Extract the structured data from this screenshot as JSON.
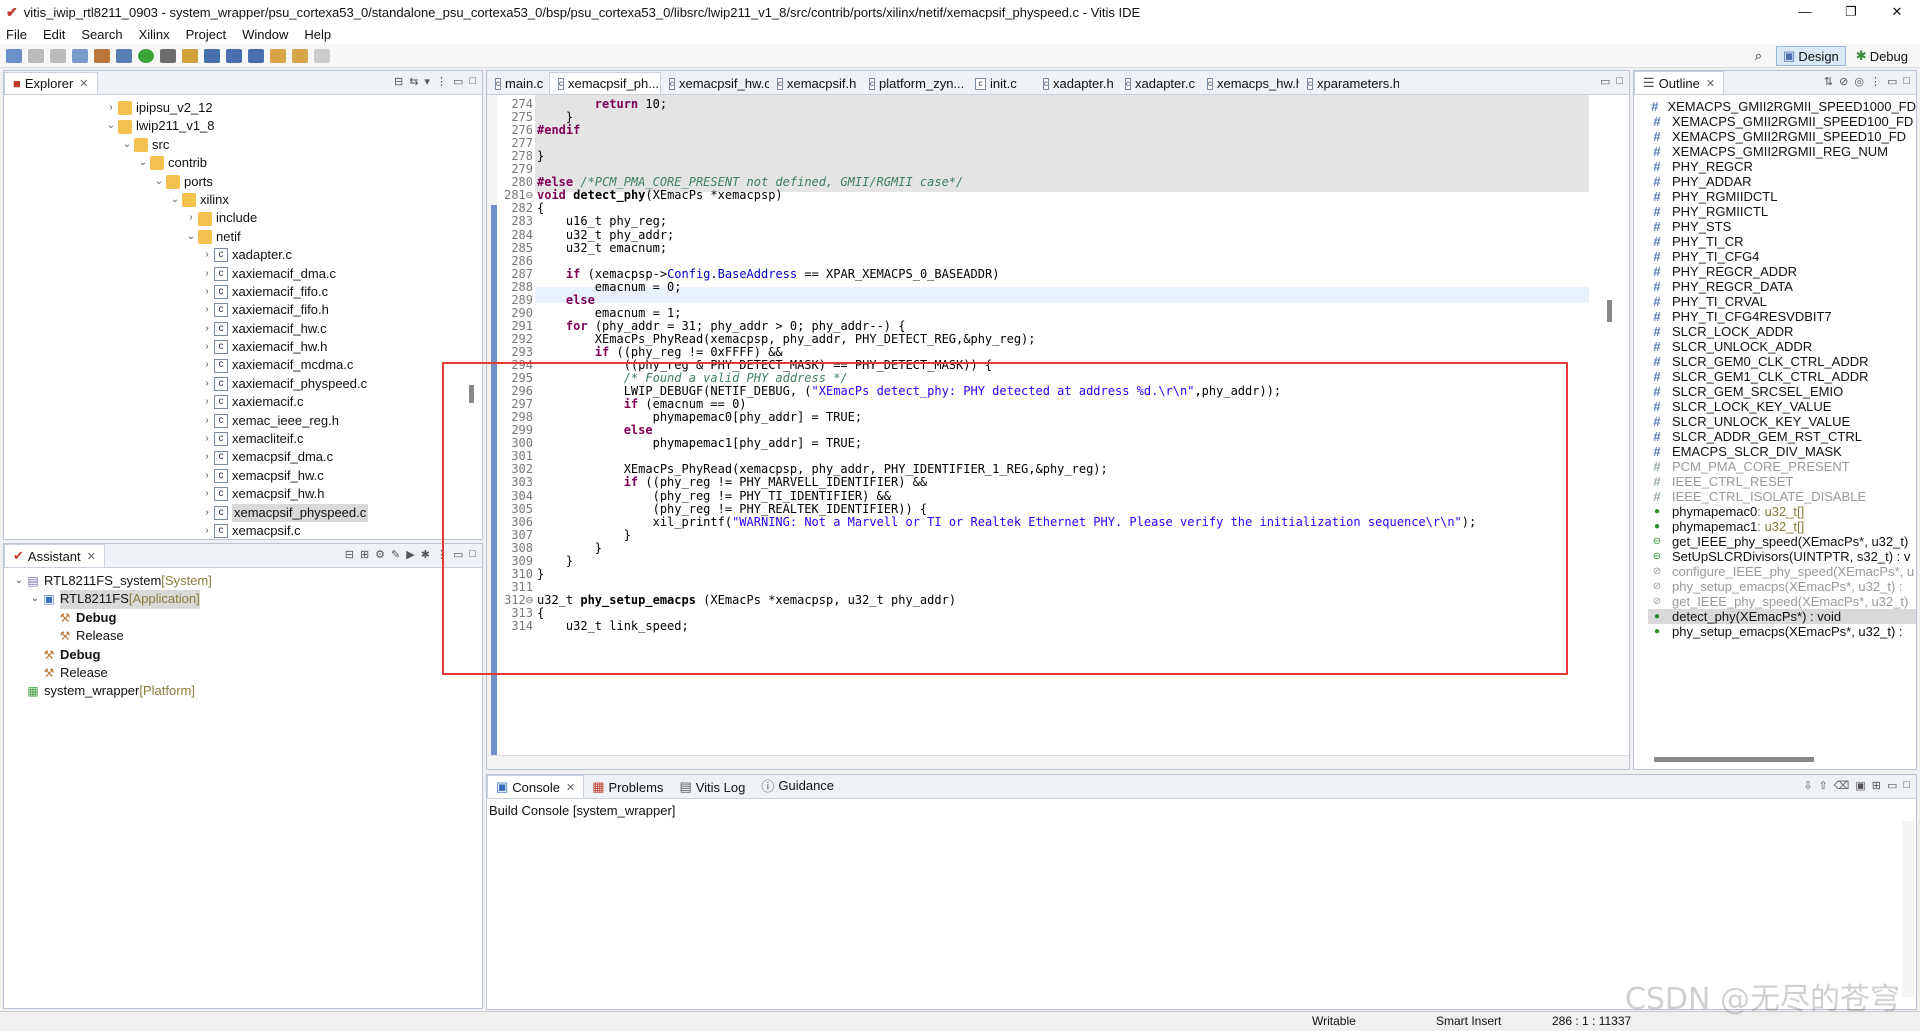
{
  "window": {
    "title": "vitis_iwip_rtl8211_0903 - system_wrapper/psu_cortexa53_0/standalone_psu_cortexa53_0/bsp/psu_cortexa53_0/libsrc/lwip211_v1_8/src/contrib/ports/xilinx/netif/xemacpsif_physpeed.c - Vitis IDE"
  },
  "menu": [
    "File",
    "Edit",
    "Search",
    "Xilinx",
    "Project",
    "Window",
    "Help"
  ],
  "perspectives": {
    "design": "Design",
    "debug": "Debug"
  },
  "explorer": {
    "tab": "Explorer",
    "items": [
      {
        "label": "ipipsu_v2_12",
        "depth": 6,
        "kind": "folder",
        "arrow": "›"
      },
      {
        "label": "lwip211_v1_8",
        "depth": 6,
        "kind": "folder",
        "arrow": "⌄"
      },
      {
        "label": "src",
        "depth": 7,
        "kind": "folder",
        "arrow": "⌄"
      },
      {
        "label": "contrib",
        "depth": 8,
        "kind": "folder",
        "arrow": "⌄"
      },
      {
        "label": "ports",
        "depth": 9,
        "kind": "folder",
        "arrow": "⌄"
      },
      {
        "label": "xilinx",
        "depth": 10,
        "kind": "folder",
        "arrow": "⌄"
      },
      {
        "label": "include",
        "depth": 11,
        "kind": "folder",
        "arrow": "›"
      },
      {
        "label": "netif",
        "depth": 11,
        "kind": "folder",
        "arrow": "⌄"
      },
      {
        "label": "xadapter.c",
        "depth": 12,
        "kind": "file",
        "arrow": "›"
      },
      {
        "label": "xaxiemacif_dma.c",
        "depth": 12,
        "kind": "file",
        "arrow": "›"
      },
      {
        "label": "xaxiemacif_fifo.c",
        "depth": 12,
        "kind": "file",
        "arrow": "›"
      },
      {
        "label": "xaxiemacif_fifo.h",
        "depth": 12,
        "kind": "file",
        "arrow": "›"
      },
      {
        "label": "xaxiemacif_hw.c",
        "depth": 12,
        "kind": "file",
        "arrow": "›"
      },
      {
        "label": "xaxiemacif_hw.h",
        "depth": 12,
        "kind": "file",
        "arrow": "›"
      },
      {
        "label": "xaxiemacif_mcdma.c",
        "depth": 12,
        "kind": "file",
        "arrow": "›"
      },
      {
        "label": "xaxiemacif_physpeed.c",
        "depth": 12,
        "kind": "file",
        "arrow": "›"
      },
      {
        "label": "xaxiemacif.c",
        "depth": 12,
        "kind": "file",
        "arrow": "›"
      },
      {
        "label": "xemac_ieee_reg.h",
        "depth": 12,
        "kind": "file",
        "arrow": "›"
      },
      {
        "label": "xemacliteif.c",
        "depth": 12,
        "kind": "file",
        "arrow": "›"
      },
      {
        "label": "xemacpsif_dma.c",
        "depth": 12,
        "kind": "file",
        "arrow": "›"
      },
      {
        "label": "xemacpsif_hw.c",
        "depth": 12,
        "kind": "file",
        "arrow": "›"
      },
      {
        "label": "xemacpsif_hw.h",
        "depth": 12,
        "kind": "file",
        "arrow": "›"
      },
      {
        "label": "xemacpsif_physpeed.c",
        "depth": 12,
        "kind": "file",
        "arrow": "›",
        "selected": true
      },
      {
        "label": "xemacpsif.c",
        "depth": 12,
        "kind": "file",
        "arrow": "›"
      }
    ]
  },
  "assistant": {
    "tab": "Assistant",
    "items": [
      {
        "label": "RTL8211FS_system",
        "suffix": " [System]",
        "depth": 0,
        "arrow": "⌄",
        "icon": "sys"
      },
      {
        "label": "RTL8211FS",
        "suffix": " [Application]",
        "depth": 1,
        "arrow": "⌄",
        "icon": "app",
        "selected": true
      },
      {
        "label": "Debug",
        "suffix": "",
        "depth": 2,
        "arrow": "",
        "icon": "hammer",
        "bold": true
      },
      {
        "label": "Release",
        "suffix": "",
        "depth": 2,
        "arrow": "",
        "icon": "hammer"
      },
      {
        "label": "Debug",
        "suffix": "",
        "depth": 1,
        "arrow": "",
        "icon": "hammer",
        "bold": true
      },
      {
        "label": "Release",
        "suffix": "",
        "depth": 1,
        "arrow": "",
        "icon": "hammer"
      },
      {
        "label": "system_wrapper",
        "suffix": " [Platform]",
        "depth": 0,
        "arrow": "",
        "icon": "plat"
      }
    ]
  },
  "editor": {
    "tabs": [
      "main.c",
      "xemacpsif_ph...",
      "xemacpsif_hw.c",
      "xemacpsif.h",
      "platform_zyn...",
      "init.c",
      "xadapter.h",
      "xadapter.c",
      "xemacps_hw.h",
      "xparameters.h"
    ],
    "active_tab": 1,
    "lines": [
      {
        "n": "274",
        "t": "        return 10;"
      },
      {
        "n": "275",
        "t": "    }"
      },
      {
        "n": "276",
        "t": "#endif"
      },
      {
        "n": "277",
        "t": ""
      },
      {
        "n": "278",
        "t": "}"
      },
      {
        "n": "279",
        "t": ""
      },
      {
        "n": "280",
        "t": "#else /*PCM_PMA_CORE_PRESENT not defined, GMII/RGMII case*/"
      },
      {
        "n": "281⊖",
        "t": "void detect_phy(XEmacPs *xemacpsp)"
      },
      {
        "n": "282",
        "t": "{"
      },
      {
        "n": "283",
        "t": "    u16_t phy_reg;"
      },
      {
        "n": "284",
        "t": "    u32_t phy_addr;"
      },
      {
        "n": "285",
        "t": "    u32_t emacnum;"
      },
      {
        "n": "286",
        "t": ""
      },
      {
        "n": "287",
        "t": "    if (xemacpsp->Config.BaseAddress == XPAR_XEMACPS_0_BASEADDR)"
      },
      {
        "n": "288",
        "t": "        emacnum = 0;"
      },
      {
        "n": "289",
        "t": "    else"
      },
      {
        "n": "290",
        "t": "        emacnum = 1;"
      },
      {
        "n": "291",
        "t": "    for (phy_addr = 31; phy_addr > 0; phy_addr--) {"
      },
      {
        "n": "292",
        "t": "        XEmacPs_PhyRead(xemacpsp, phy_addr, PHY_DETECT_REG,&phy_reg);"
      },
      {
        "n": "293",
        "t": "        if ((phy_reg != 0xFFFF) &&"
      },
      {
        "n": "294",
        "t": "            ((phy_reg & PHY_DETECT_MASK) == PHY_DETECT_MASK)) {"
      },
      {
        "n": "295",
        "t": "            /* Found a valid PHY address */"
      },
      {
        "n": "296",
        "t": "            LWIP_DEBUGF(NETIF_DEBUG, (\"XEmacPs detect_phy: PHY detected at address %d.\\r\\n\",phy_addr));"
      },
      {
        "n": "297",
        "t": "            if (emacnum == 0)"
      },
      {
        "n": "298",
        "t": "                phymapemac0[phy_addr] = TRUE;"
      },
      {
        "n": "299",
        "t": "            else"
      },
      {
        "n": "300",
        "t": "                phymapemac1[phy_addr] = TRUE;"
      },
      {
        "n": "301",
        "t": ""
      },
      {
        "n": "302",
        "t": "            XEmacPs_PhyRead(xemacpsp, phy_addr, PHY_IDENTIFIER_1_REG,&phy_reg);"
      },
      {
        "n": "303",
        "t": "            if ((phy_reg != PHY_MARVELL_IDENTIFIER) &&"
      },
      {
        "n": "304",
        "t": "                (phy_reg != PHY_TI_IDENTIFIER) &&"
      },
      {
        "n": "305",
        "t": "                (phy_reg != PHY_REALTEK_IDENTIFIER)) {"
      },
      {
        "n": "306",
        "t": "                xil_printf(\"WARNING: Not a Marvell or TI or Realtek Ethernet PHY. Please verify the initialization sequence\\r\\n\");"
      },
      {
        "n": "307",
        "t": "            }"
      },
      {
        "n": "308",
        "t": "        }"
      },
      {
        "n": "309",
        "t": "    }"
      },
      {
        "n": "310",
        "t": "}"
      },
      {
        "n": "311",
        "t": ""
      },
      {
        "n": "312⊖",
        "t": "u32_t phy_setup_emacps (XEmacPs *xemacpsp, u32_t phy_addr)"
      },
      {
        "n": "313",
        "t": "{"
      },
      {
        "n": "314",
        "t": "    u32_t link_speed;"
      }
    ]
  },
  "outline": {
    "tab": "Outline",
    "items": [
      {
        "label": "XEMACPS_GMII2RGMII_SPEED1000_FD",
        "kind": "hash"
      },
      {
        "label": "XEMACPS_GMII2RGMII_SPEED100_FD",
        "kind": "hash"
      },
      {
        "label": "XEMACPS_GMII2RGMII_SPEED10_FD",
        "kind": "hash"
      },
      {
        "label": "XEMACPS_GMII2RGMII_REG_NUM",
        "kind": "hash"
      },
      {
        "label": "PHY_REGCR",
        "kind": "hash"
      },
      {
        "label": "PHY_ADDAR",
        "kind": "hash"
      },
      {
        "label": "PHY_RGMIIDCTL",
        "kind": "hash"
      },
      {
        "label": "PHY_RGMIICTL",
        "kind": "hash"
      },
      {
        "label": "PHY_STS",
        "kind": "hash"
      },
      {
        "label": "PHY_TI_CR",
        "kind": "hash"
      },
      {
        "label": "PHY_TI_CFG4",
        "kind": "hash"
      },
      {
        "label": "PHY_REGCR_ADDR",
        "kind": "hash"
      },
      {
        "label": "PHY_REGCR_DATA",
        "kind": "hash"
      },
      {
        "label": "PHY_TI_CRVAL",
        "kind": "hash"
      },
      {
        "label": "PHY_TI_CFG4RESVDBIT7",
        "kind": "hash"
      },
      {
        "label": "SLCR_LOCK_ADDR",
        "kind": "hash"
      },
      {
        "label": "SLCR_UNLOCK_ADDR",
        "kind": "hash"
      },
      {
        "label": "SLCR_GEM0_CLK_CTRL_ADDR",
        "kind": "hash"
      },
      {
        "label": "SLCR_GEM1_CLK_CTRL_ADDR",
        "kind": "hash"
      },
      {
        "label": "SLCR_GEM_SRCSEL_EMIO",
        "kind": "hash"
      },
      {
        "label": "SLCR_LOCK_KEY_VALUE",
        "kind": "hash"
      },
      {
        "label": "SLCR_UNLOCK_KEY_VALUE",
        "kind": "hash"
      },
      {
        "label": "SLCR_ADDR_GEM_RST_CTRL",
        "kind": "hash"
      },
      {
        "label": "EMACPS_SLCR_DIV_MASK",
        "kind": "hash"
      },
      {
        "label": "PCM_PMA_CORE_PRESENT",
        "kind": "hashg"
      },
      {
        "label": "IEEE_CTRL_RESET",
        "kind": "hashg"
      },
      {
        "label": "IEEE_CTRL_ISOLATE_DISABLE",
        "kind": "hashg"
      },
      {
        "label": "phymapemac0",
        "type": " : u32_t[]",
        "kind": "dot"
      },
      {
        "label": "phymapemac1",
        "type": " : u32_t[]",
        "kind": "dot"
      },
      {
        "label": "get_IEEE_phy_speed(XEmacPs*, u32_t)",
        "kind": "fn"
      },
      {
        "label": "SetUpSLCRDivisors(UINTPTR, s32_t) : v",
        "kind": "fn"
      },
      {
        "label": "configure_IEEE_phy_speed(XEmacPs*, u",
        "kind": "fng"
      },
      {
        "label": "phy_setup_emacps(XEmacPs*, u32_t) :",
        "kind": "fng"
      },
      {
        "label": "get_IEEE_phy_speed(XEmacPs*, u32_t)",
        "kind": "fng"
      },
      {
        "label": "detect_phy(XEmacPs*) : void",
        "kind": "dot",
        "selected": true
      },
      {
        "label": "phy_setup_emacps(XEmacPs*, u32_t) :",
        "kind": "dot"
      }
    ]
  },
  "console": {
    "tabs": [
      "Console",
      "Problems",
      "Vitis Log",
      "Guidance"
    ],
    "header": "Build Console [system_wrapper]"
  },
  "status": {
    "writable": "Writable",
    "insert": "Smart Insert",
    "position": "286 : 1 : 11337"
  },
  "watermark": "CSDN @无尽的苍穹"
}
